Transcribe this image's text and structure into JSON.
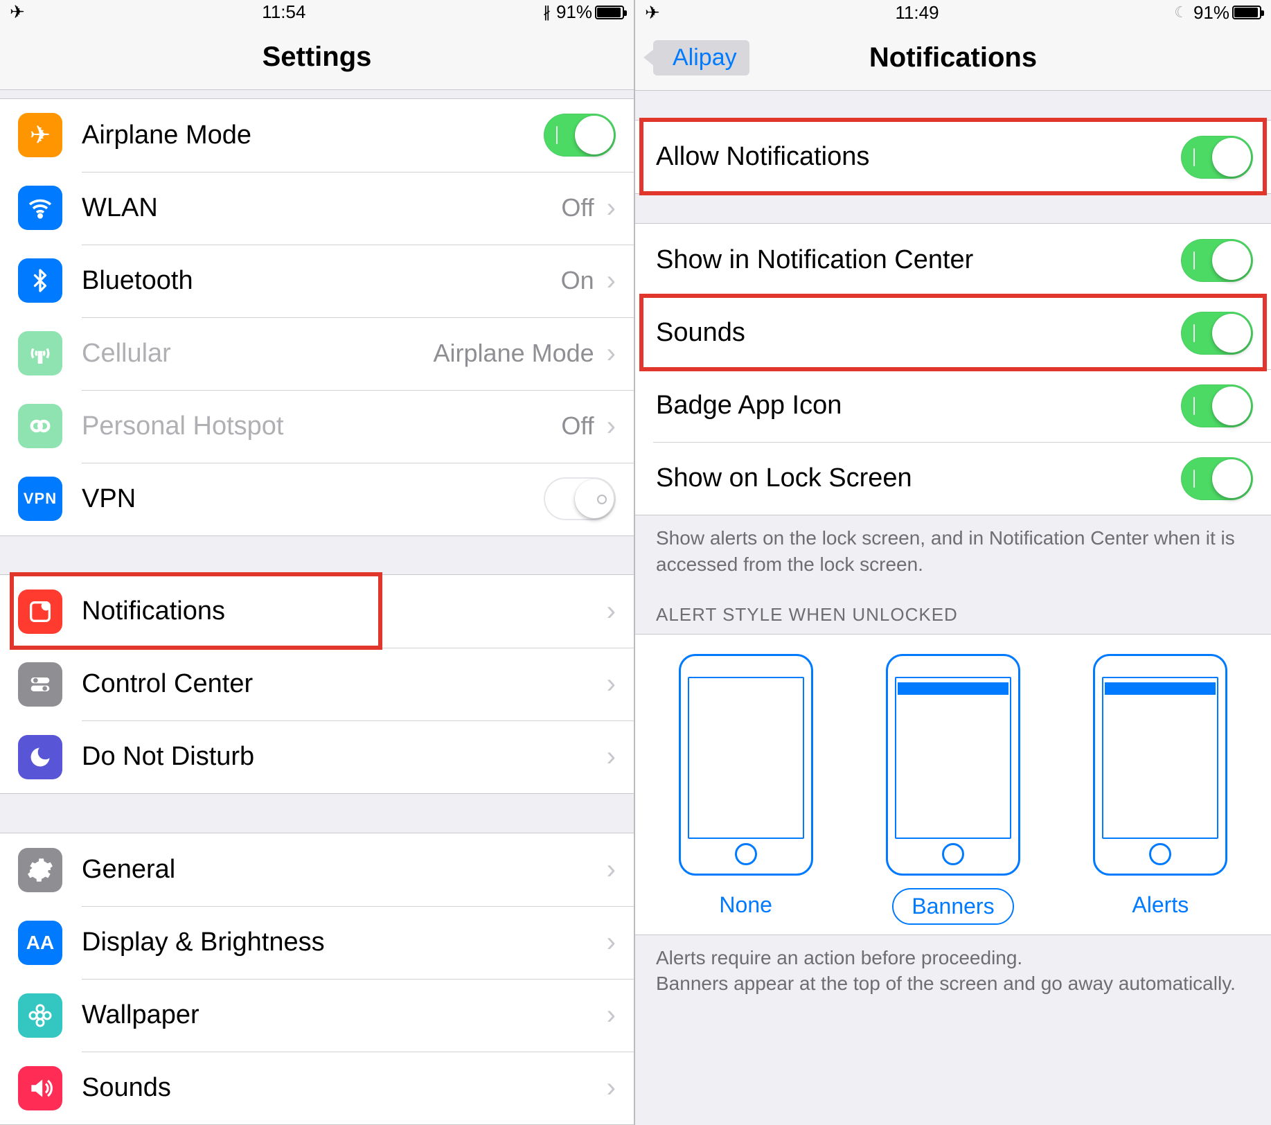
{
  "left": {
    "status": {
      "time": "11:54",
      "batt_pct": "91%"
    },
    "title": "Settings",
    "group1": [
      {
        "label": "Airplane Mode",
        "detail": "",
        "toggle": "on",
        "icon": "airplane"
      },
      {
        "label": "WLAN",
        "detail": "Off",
        "icon": "wifi"
      },
      {
        "label": "Bluetooth",
        "detail": "On",
        "icon": "bluetooth"
      },
      {
        "label": "Cellular",
        "detail": "Airplane Mode",
        "icon": "cellular",
        "disabled": true
      },
      {
        "label": "Personal Hotspot",
        "detail": "Off",
        "icon": "hotspot",
        "disabled": true
      },
      {
        "label": "VPN",
        "detail": "",
        "toggle": "off",
        "icon": "vpn"
      }
    ],
    "group2": [
      {
        "label": "Notifications",
        "icon": "notifications"
      },
      {
        "label": "Control Center",
        "icon": "control-center"
      },
      {
        "label": "Do Not Disturb",
        "icon": "dnd"
      }
    ],
    "group3": [
      {
        "label": "General",
        "icon": "general"
      },
      {
        "label": "Display & Brightness",
        "icon": "display"
      },
      {
        "label": "Wallpaper",
        "icon": "wallpaper"
      },
      {
        "label": "Sounds",
        "icon": "sounds"
      }
    ]
  },
  "right": {
    "status": {
      "time": "11:49",
      "batt_pct": "91%"
    },
    "back": "Alipay",
    "title": "Notifications",
    "allow": {
      "label": "Allow Notifications",
      "on": true
    },
    "opts": [
      {
        "label": "Show in Notification Center",
        "on": true
      },
      {
        "label": "Sounds",
        "on": true
      },
      {
        "label": "Badge App Icon",
        "on": true
      },
      {
        "label": "Show on Lock Screen",
        "on": true
      }
    ],
    "opts_footer": "Show alerts on the lock screen, and in Notification Center when it is accessed from the lock screen.",
    "alert_header": "ALERT STYLE WHEN UNLOCKED",
    "alert_styles": [
      {
        "label": "None",
        "selected": false,
        "bar": false
      },
      {
        "label": "Banners",
        "selected": true,
        "bar": true
      },
      {
        "label": "Alerts",
        "selected": false,
        "bar": true
      }
    ],
    "alert_footer": "Alerts require an action before proceeding.\nBanners appear at the top of the screen and go away automatically."
  }
}
